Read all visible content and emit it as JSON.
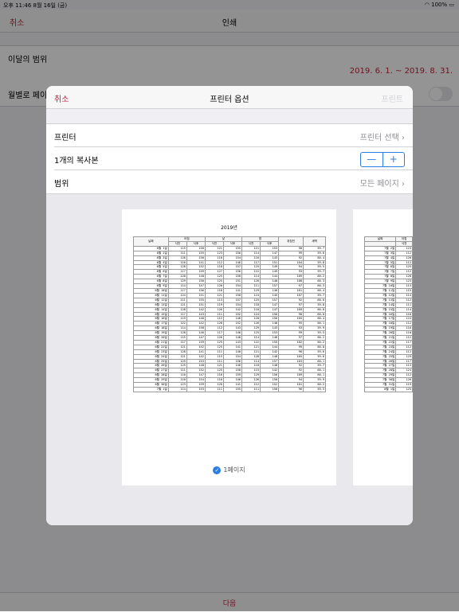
{
  "statusbar": {
    "time_date": "오후 11:46   8월 16일 (금)",
    "battery": "100%"
  },
  "background_screen": {
    "nav": {
      "cancel_label": "취소",
      "title": "인쇄"
    },
    "range_label": "이달의 범위",
    "range_dates": "2019. 6. 1.  ~  2019. 8. 31.",
    "monthly_label": "월별로 페이지",
    "bottom_button_label": "다음"
  },
  "printer_options": {
    "nav": {
      "cancel_label": "취소",
      "title": "프린터 옵션",
      "print_label": "프린트"
    },
    "printer": {
      "label": "프린터",
      "value": "프린터 선택 ›"
    },
    "copies": {
      "label": "1개의 복사본",
      "minus": "—",
      "plus": "+"
    },
    "range": {
      "label": "범위",
      "value": "모든 페이지 ›"
    },
    "page_label": "1페이지",
    "check_mark": "✓"
  },
  "preview_page1": {
    "title": "2019년",
    "headers_top": [
      "날짜",
      "아침",
      "낮",
      "밤",
      "취침전",
      "새벽"
    ],
    "headers_sub": [
      "식전",
      "식후",
      "식전",
      "식후",
      "식전",
      "식후"
    ],
    "rows": [
      [
        "6월 1일",
        "115",
        "150",
        "121",
        "155",
        "121",
        "153",
        "98",
        "59.7"
      ],
      [
        "6월 2일",
        "111",
        "155",
        "123",
        "150",
        "114",
        "147",
        "99",
        "59.6"
      ],
      [
        "6월 3일",
        "126",
        "150",
        "116",
        "154",
        "116",
        "143",
        "92",
        "60.4"
      ],
      [
        "6월 4일",
        "116",
        "141",
        "112",
        "146",
        "117",
        "151",
        "104",
        "59.8"
      ],
      [
        "6월 5일",
        "128",
        "152",
        "118",
        "157",
        "125",
        "149",
        "94",
        "59.5"
      ],
      [
        "6월 6일",
        "117",
        "159",
        "127",
        "156",
        "122",
        "149",
        "93",
        "59.7"
      ],
      [
        "6월 7일",
        "120",
        "148",
        "125",
        "150",
        "114",
        "144",
        "109",
        "60.2"
      ],
      [
        "6월 8일",
        "129",
        "150",
        "125",
        "151",
        "126",
        "140",
        "108",
        "60.3"
      ],
      [
        "6월 9일",
        "114",
        "147",
        "120",
        "154",
        "111",
        "157",
        "97",
        "60.3"
      ],
      [
        "6월 10일",
        "117",
        "156",
        "118",
        "141",
        "129",
        "140",
        "101",
        "60.4"
      ],
      [
        "6월 11일",
        "124",
        "151",
        "121",
        "150",
        "124",
        "145",
        "107",
        "59.7"
      ],
      [
        "6월 12일",
        "111",
        "155",
        "113",
        "157",
        "125",
        "157",
        "92",
        "60.0"
      ],
      [
        "6월 13일",
        "121",
        "151",
        "119",
        "154",
        "118",
        "147",
        "97",
        "59.8"
      ],
      [
        "6월 14일",
        "128",
        "142",
        "126",
        "142",
        "116",
        "147",
        "109",
        "60.0"
      ],
      [
        "6월 15일",
        "117",
        "143",
        "111",
        "152",
        "124",
        "156",
        "98",
        "60.0"
      ],
      [
        "6월 16일",
        "119",
        "140",
        "112",
        "146",
        "120",
        "156",
        "105",
        "60.4"
      ],
      [
        "6월 17일",
        "122",
        "142",
        "128",
        "152",
        "126",
        "148",
        "95",
        "60.1"
      ],
      [
        "6월 18일",
        "114",
        "158",
        "112",
        "143",
        "129",
        "143",
        "93",
        "59.9"
      ],
      [
        "6월 19일",
        "128",
        "146",
        "117",
        "146",
        "125",
        "153",
        "99",
        "59.5"
      ],
      [
        "6월 20일",
        "115",
        "147",
        "126",
        "148",
        "114",
        "148",
        "97",
        "60.2"
      ],
      [
        "6월 21일",
        "117",
        "159",
        "125",
        "143",
        "122",
        "155",
        "102",
        "60.2"
      ],
      [
        "6월 22일",
        "121",
        "142",
        "125",
        "141",
        "121",
        "144",
        "99",
        "60.0"
      ],
      [
        "6월 23일",
        "128",
        "141",
        "111",
        "140",
        "121",
        "142",
        "96",
        "59.6"
      ],
      [
        "6월 24일",
        "121",
        "142",
        "115",
        "154",
        "128",
        "148",
        "105",
        "59.6"
      ],
      [
        "6월 25일",
        "125",
        "153",
        "111",
        "156",
        "114",
        "157",
        "103",
        "60.1"
      ],
      [
        "6월 26일",
        "125",
        "148",
        "121",
        "146",
        "118",
        "148",
        "92",
        "59.7"
      ],
      [
        "6월 27일",
        "111",
        "152",
        "125",
        "150",
        "115",
        "142",
        "92",
        "60.1"
      ],
      [
        "6월 28일",
        "110",
        "147",
        "116",
        "159",
        "129",
        "156",
        "109",
        "60.1"
      ],
      [
        "6월 29일",
        "110",
        "154",
        "110",
        "146",
        "126",
        "150",
        "94",
        "59.9"
      ],
      [
        "6월 30일",
        "123",
        "159",
        "126",
        "141",
        "112",
        "152",
        "101",
        "60.2"
      ],
      [
        "7월 1일",
        "114",
        "153",
        "111",
        "155",
        "111",
        "150",
        "96",
        "59.5"
      ]
    ]
  },
  "preview_page2": {
    "headers_top": [
      "날짜",
      "아침"
    ],
    "headers_sub": [
      "",
      "식전"
    ],
    "rows": [
      [
        "7월 2일",
        "123"
      ],
      [
        "7월 3일",
        "112"
      ],
      [
        "7월 4일",
        "126"
      ],
      [
        "7월 5일",
        "112"
      ],
      [
        "7월 6일",
        "125"
      ],
      [
        "7월 7일",
        "112"
      ],
      [
        "7월 8일",
        "128"
      ],
      [
        "7월 9일",
        "123"
      ],
      [
        "7월 10일",
        "113"
      ],
      [
        "7월 11일",
        "115"
      ],
      [
        "7월 12일",
        "114"
      ],
      [
        "7월 13일",
        "112"
      ],
      [
        "7월 14일",
        "111"
      ],
      [
        "7월 15일",
        "114"
      ],
      [
        "7월 16일",
        "118"
      ],
      [
        "7월 17일",
        "124"
      ],
      [
        "7월 18일",
        "112"
      ],
      [
        "7월 19일",
        "116"
      ],
      [
        "7월 20일",
        "110"
      ],
      [
        "7월 21일",
        "112"
      ],
      [
        "7월 22일",
        "117"
      ],
      [
        "7월 23일",
        "112"
      ],
      [
        "7월 24일",
        "112"
      ],
      [
        "7월 25일",
        "129"
      ],
      [
        "7월 26일",
        "117"
      ],
      [
        "7월 27일",
        "113"
      ],
      [
        "7월 28일",
        "124"
      ],
      [
        "7월 29일",
        "112"
      ],
      [
        "7월 30일",
        "126"
      ],
      [
        "7월 31일",
        "119"
      ],
      [
        "8월 1일",
        "125"
      ]
    ]
  }
}
